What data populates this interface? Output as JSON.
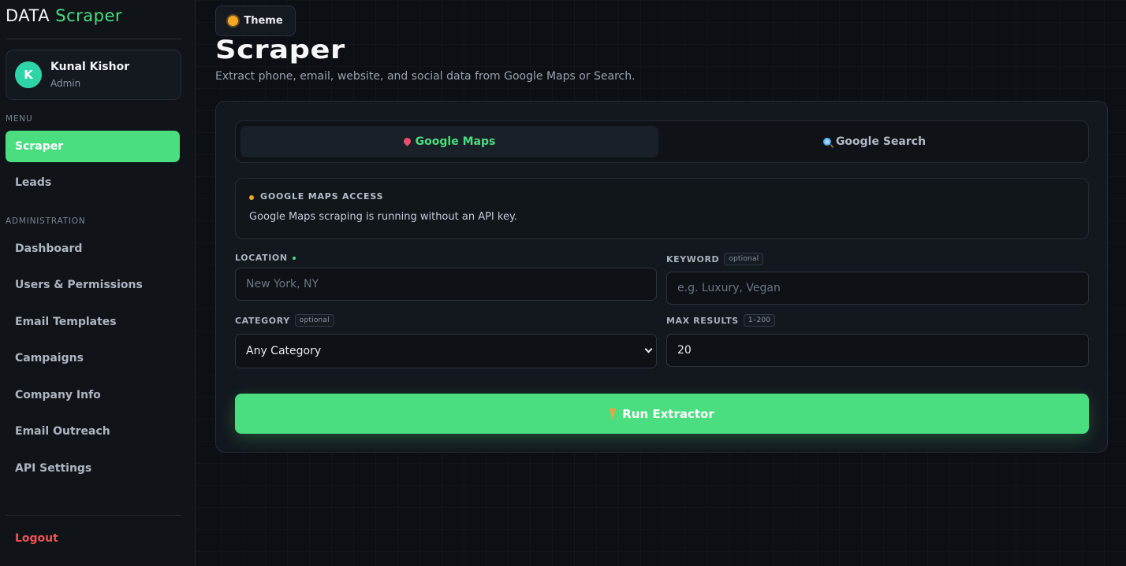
{
  "sidebar": {
    "brand_main": "DATA",
    "brand_accent": "Scraper",
    "user": {
      "initial": "K",
      "name": "Kunal Kishor",
      "role": "Admin"
    },
    "sections": {
      "menu": "MENU",
      "admin": "ADMINISTRATION"
    },
    "menu_items": [
      {
        "label": "Scraper",
        "active": true
      },
      {
        "label": "Leads",
        "active": false
      }
    ],
    "admin_items": [
      {
        "label": "Dashboard"
      },
      {
        "label": "Users & Permissions"
      },
      {
        "label": "Email Templates"
      },
      {
        "label": "Campaigns"
      },
      {
        "label": "Company Info"
      },
      {
        "label": "Email Outreach"
      },
      {
        "label": "API Settings"
      }
    ],
    "logout": "Logout"
  },
  "header": {
    "theme_label": "Theme",
    "title": "Scraper",
    "subtitle": "Extract phone, email, website, and social data from Google Maps or Search."
  },
  "panel": {
    "tabs": [
      {
        "label": "Google Maps",
        "icon": "pin-icon",
        "active": true
      },
      {
        "label": "Google Search",
        "icon": "magnifier-icon",
        "active": false
      }
    ],
    "notice": {
      "title": "GOOGLE MAPS ACCESS",
      "text": "Google Maps scraping is running without an API key."
    },
    "fields": {
      "location": {
        "label": "LOCATION",
        "placeholder": "New York, NY",
        "value": ""
      },
      "keyword": {
        "label": "KEYWORD",
        "badge": "optional",
        "placeholder": "e.g. Luxury, Vegan",
        "value": ""
      },
      "category": {
        "label": "CATEGORY",
        "badge": "optional",
        "value": "Any Category"
      },
      "max_results": {
        "label": "MAX RESULTS",
        "badge": "1–200",
        "value": "20"
      }
    },
    "run_label": "Run Extractor"
  },
  "colors": {
    "accent": "#4ade80",
    "background": "#0c0f13",
    "danger": "#f05252",
    "warning": "#f5a623"
  }
}
